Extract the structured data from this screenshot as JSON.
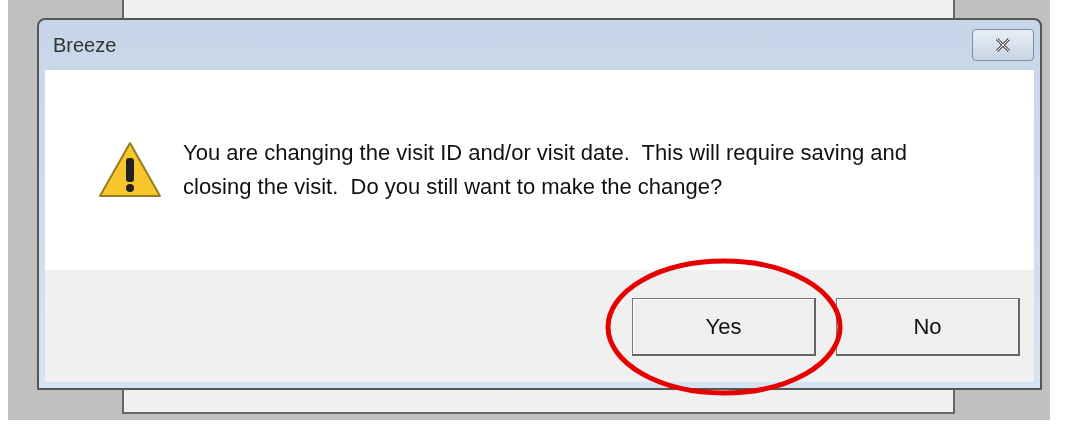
{
  "dialog": {
    "title": "Breeze",
    "message": "You are changing the visit ID and/or visit date.  This will require saving and closing the visit.  Do you still want to make the change?",
    "buttons": [
      {
        "label": "Yes",
        "highlighted": true
      },
      {
        "label": "No",
        "highlighted": false
      }
    ]
  }
}
